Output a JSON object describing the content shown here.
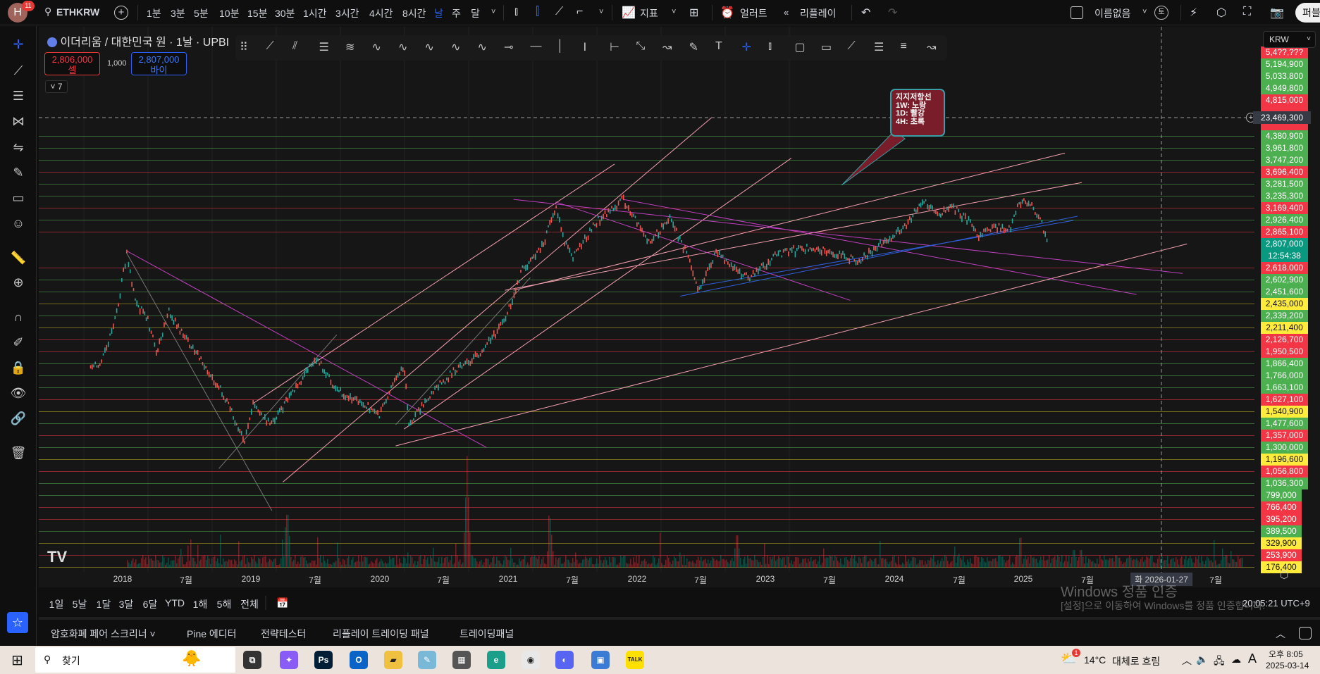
{
  "topbar": {
    "avatar_letter": "H",
    "notif_count": "11",
    "symbol": "ETHKRW",
    "intervals": [
      "1분",
      "3분",
      "5분",
      "10분",
      "15분",
      "30분",
      "1시간",
      "3시간",
      "4시간",
      "8시간",
      "날",
      "주",
      "달"
    ],
    "active_interval": "날",
    "indicators_label": "지표",
    "alert_label": "얼러트",
    "replay_label": "리플레이",
    "layout_name": "이름없음",
    "layout_badge": "토",
    "publish_label": "퍼블"
  },
  "legend": {
    "title": "이더리움 / 대한민국 원 · 1날 · UPBI",
    "sell_price": "2,806,000",
    "sell_label": "셀",
    "spread": "1,000",
    "buy_price": "2,807,000",
    "buy_label": "바이",
    "collapse_count": "7"
  },
  "callout": {
    "lines": [
      "지지저항선",
      "1W: 노랑",
      "1D: 빨강",
      "4H: 초록"
    ]
  },
  "price_axis": {
    "currency": "KRW",
    "crosshair_price": "23,469,300",
    "current_price": "2,807,000",
    "countdown": "12:54:38",
    "colors": {
      "green": "#4caf50",
      "red": "#f23645",
      "yellow": "#ffeb3b",
      "teal": "#089981"
    },
    "labels": [
      {
        "v": "5,4??,???",
        "c": "red"
      },
      {
        "v": "5,194,900",
        "c": "green"
      },
      {
        "v": "5,033,800",
        "c": "green"
      },
      {
        "v": "4,949,800",
        "c": "green"
      },
      {
        "v": "4,815,000",
        "c": "red"
      },
      {
        "v": "",
        "c": "red"
      },
      {
        "v": "",
        "c": "red"
      },
      {
        "v": "4,380,900",
        "c": "green"
      },
      {
        "v": "3,961,800",
        "c": "green"
      },
      {
        "v": "3,747,200",
        "c": "green"
      },
      {
        "v": "3,696,400",
        "c": "red"
      },
      {
        "v": "3,281,500",
        "c": "green"
      },
      {
        "v": "3,235,300",
        "c": "green"
      },
      {
        "v": "3,169,400",
        "c": "red"
      },
      {
        "v": "2,926,400",
        "c": "green"
      },
      {
        "v": "2,865,100",
        "c": "red"
      },
      {
        "v": "2,807,000",
        "c": "teal"
      },
      {
        "v": "12:54:38",
        "c": "teal"
      },
      {
        "v": "2,618,000",
        "c": "red"
      },
      {
        "v": "2,602,900",
        "c": "green"
      },
      {
        "v": "2,451,600",
        "c": "green"
      },
      {
        "v": "2,435,000",
        "c": "yellow"
      },
      {
        "v": "2,339,200",
        "c": "green"
      },
      {
        "v": "2,211,400",
        "c": "yellow"
      },
      {
        "v": "2,126,700",
        "c": "red"
      },
      {
        "v": "1,950,500",
        "c": "red"
      },
      {
        "v": "1,866,400",
        "c": "green"
      },
      {
        "v": "1,766,000",
        "c": "green"
      },
      {
        "v": "1,663,100",
        "c": "green"
      },
      {
        "v": "1,627,100",
        "c": "red"
      },
      {
        "v": "1,540,900",
        "c": "yellow"
      },
      {
        "v": "1,477,600",
        "c": "green"
      },
      {
        "v": "1,357,000",
        "c": "red"
      },
      {
        "v": "1,300,000",
        "c": "green"
      },
      {
        "v": "1,196,600",
        "c": "yellow"
      },
      {
        "v": "1,056,800",
        "c": "red"
      },
      {
        "v": "1,036,300",
        "c": "green"
      },
      {
        "v": "799,000",
        "c": "green"
      },
      {
        "v": "766,400",
        "c": "red"
      },
      {
        "v": "395,200",
        "c": "red"
      },
      {
        "v": "389,500",
        "c": "green"
      },
      {
        "v": "329,900",
        "c": "yellow"
      },
      {
        "v": "253,900",
        "c": "red"
      },
      {
        "v": "176,400",
        "c": "yellow"
      }
    ]
  },
  "time_axis": {
    "labels": [
      "2018",
      "7월",
      "2019",
      "7월",
      "2020",
      "7월",
      "2021",
      "7월",
      "2022",
      "7월",
      "2023",
      "7월",
      "2024",
      "7월",
      "2025",
      "7월",
      "7월"
    ],
    "crosshair_date": "화 2026-01-27"
  },
  "range_bar": {
    "ranges": [
      "1일",
      "5날",
      "1달",
      "3달",
      "6달",
      "YTD",
      "1해",
      "5해",
      "전체"
    ],
    "clock": "20:05:21 UTC+9"
  },
  "watermark": {
    "title": "Windows 정품 인증",
    "subtitle": "[설정]으로 이동하여 Windows를 정품 인증합니다."
  },
  "bottom_tabs": [
    "암호화폐 페어 스크리너 ˅",
    "Pine 에디터",
    "전략테스터",
    "리플레이 트레이딩 패널",
    "트레이딩패널"
  ],
  "taskbar": {
    "search_placeholder": "찾기",
    "apps": [
      "task-view",
      "copilot",
      "photoshop",
      "outlook",
      "file-explorer",
      "notepad",
      "calculator",
      "edge-beta",
      "chrome",
      "discord",
      "app",
      "kakaotalk"
    ],
    "weather_temp": "14°C",
    "weather_desc": "대체로 흐림",
    "weather_badge": "1",
    "ime": "A",
    "time": "오후 8:05",
    "date": "2025-03-14"
  }
}
